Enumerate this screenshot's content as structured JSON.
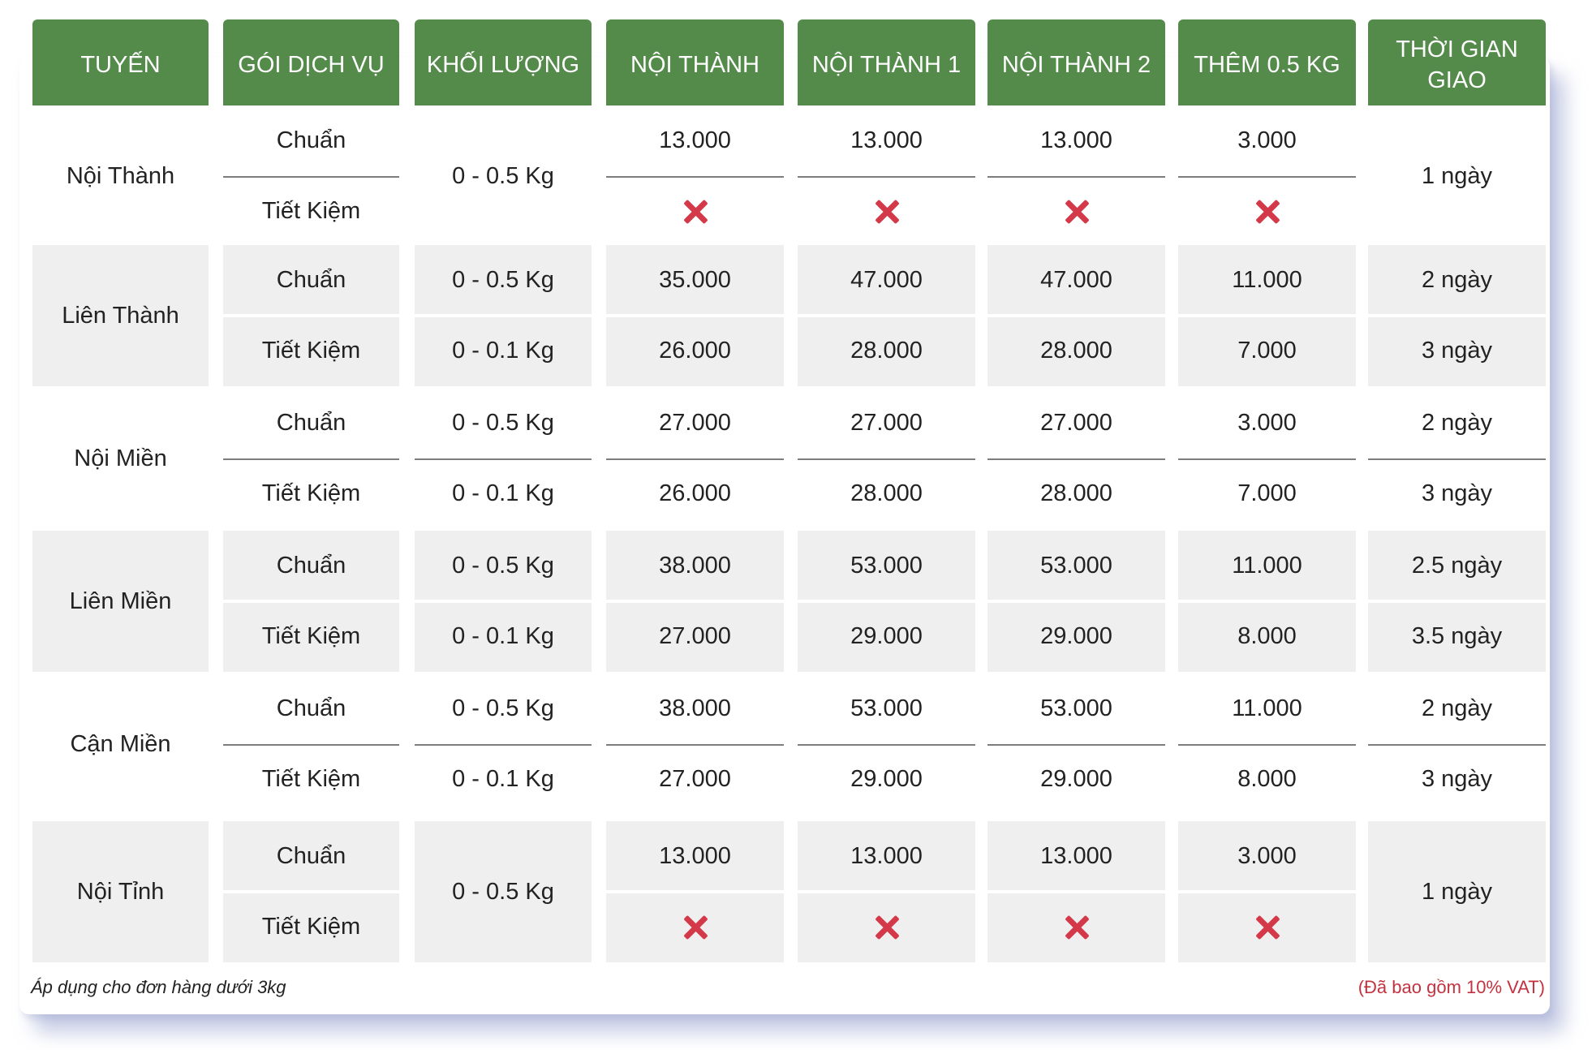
{
  "headers": [
    "TUYẾN",
    "GÓI DỊCH VỤ",
    "KHỐI LƯỢNG",
    "NỘI THÀNH",
    "NỘI THÀNH 1",
    "NỘI THÀNH 2",
    "THÊM 0.5 KG",
    "THỜI GIAN GIAO"
  ],
  "routes": [
    {
      "name": "Nội Thành",
      "weight": "0 - 0.5 Kg",
      "delivery": "1 ngày",
      "rows": [
        {
          "service": "Chuẩn",
          "noi_thanh": "13.000",
          "noi_thanh_1": "13.000",
          "noi_thanh_2": "13.000",
          "them": "3.000"
        },
        {
          "service": "Tiết Kiệm",
          "noi_thanh": "✖",
          "noi_thanh_1": "✖",
          "noi_thanh_2": "✖",
          "them": "✖"
        }
      ]
    },
    {
      "name": "Liên Thành",
      "rows": [
        {
          "service": "Chuẩn",
          "weight": "0 - 0.5 Kg",
          "noi_thanh": "35.000",
          "noi_thanh_1": "47.000",
          "noi_thanh_2": "47.000",
          "them": "11.000",
          "delivery": "2 ngày"
        },
        {
          "service": "Tiết Kiệm",
          "weight": "0 - 0.1 Kg",
          "noi_thanh": "26.000",
          "noi_thanh_1": "28.000",
          "noi_thanh_2": "28.000",
          "them": "7.000",
          "delivery": "3 ngày"
        }
      ]
    },
    {
      "name": "Nội Miền",
      "rows": [
        {
          "service": "Chuẩn",
          "weight": "0 - 0.5 Kg",
          "noi_thanh": "27.000",
          "noi_thanh_1": "27.000",
          "noi_thanh_2": "27.000",
          "them": "3.000",
          "delivery": "2 ngày"
        },
        {
          "service": "Tiết Kiệm",
          "weight": "0 - 0.1 Kg",
          "noi_thanh": "26.000",
          "noi_thanh_1": "28.000",
          "noi_thanh_2": "28.000",
          "them": "7.000",
          "delivery": "3 ngày"
        }
      ]
    },
    {
      "name": "Liên Miền",
      "rows": [
        {
          "service": "Chuẩn",
          "weight": "0 - 0.5 Kg",
          "noi_thanh": "38.000",
          "noi_thanh_1": "53.000",
          "noi_thanh_2": "53.000",
          "them": "11.000",
          "delivery": "2.5 ngày"
        },
        {
          "service": "Tiết Kiệm",
          "weight": "0 - 0.1 Kg",
          "noi_thanh": "27.000",
          "noi_thanh_1": "29.000",
          "noi_thanh_2": "29.000",
          "them": "8.000",
          "delivery": "3.5 ngày"
        }
      ]
    },
    {
      "name": "Cận Miền",
      "rows": [
        {
          "service": "Chuẩn",
          "weight": "0 - 0.5 Kg",
          "noi_thanh": "38.000",
          "noi_thanh_1": "53.000",
          "noi_thanh_2": "53.000",
          "them": "11.000",
          "delivery": "2 ngày"
        },
        {
          "service": "Tiết Kiệm",
          "weight": "0 - 0.1 Kg",
          "noi_thanh": "27.000",
          "noi_thanh_1": "29.000",
          "noi_thanh_2": "29.000",
          "them": "8.000",
          "delivery": "3 ngày"
        }
      ]
    },
    {
      "name": "Nội Tỉnh",
      "weight": "0 - 0.5 Kg",
      "delivery": "1 ngày",
      "rows": [
        {
          "service": "Chuẩn",
          "noi_thanh": "13.000",
          "noi_thanh_1": "13.000",
          "noi_thanh_2": "13.000",
          "them": "3.000"
        },
        {
          "service": "Tiết Kiệm",
          "noi_thanh": "✖",
          "noi_thanh_1": "✖",
          "noi_thanh_2": "✖",
          "them": "✖"
        }
      ]
    }
  ],
  "footer": {
    "note": "Áp dụng cho đơn hàng dưới 3kg",
    "vat": "(Đã bao gồm 10% VAT)"
  },
  "colors": {
    "header_bg": "#548b4b",
    "band_bg": "#efefef",
    "x_mark": "#d4394a",
    "vat_text": "#c3323f"
  },
  "icons": {
    "unavailable": "x-mark-icon"
  }
}
